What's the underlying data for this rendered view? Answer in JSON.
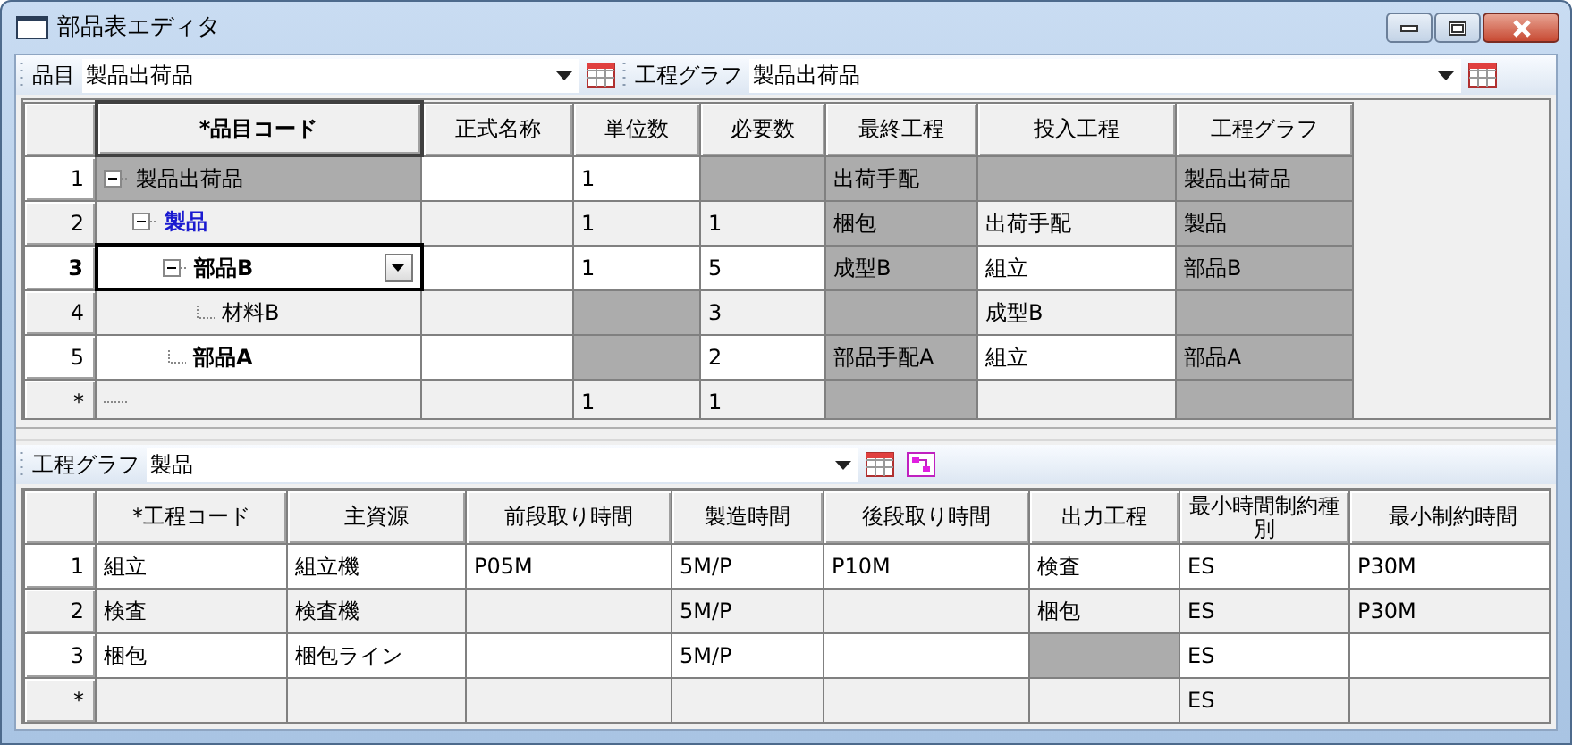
{
  "window": {
    "title": "部品表エディタ"
  },
  "toolbar": {
    "items": [
      {
        "label": "品目",
        "value": "製品出荷品"
      },
      {
        "label": "工程グラフ",
        "value": "製品出荷品"
      }
    ]
  },
  "bom_grid": {
    "columns": [
      {
        "label": "*品目コード",
        "selected": true
      },
      {
        "label": "正式名称",
        "selected": false
      },
      {
        "label": "単位数",
        "selected": false
      },
      {
        "label": "必要数",
        "selected": false
      },
      {
        "label": "最終工程",
        "selected": false
      },
      {
        "label": "投入工程",
        "selected": false
      },
      {
        "label": "工程グラフ",
        "selected": false
      }
    ],
    "rows": [
      {
        "number": "1",
        "selected": false,
        "kind": "plain",
        "expanded": true,
        "cells": [
          {
            "text": "製品出荷品",
            "shaded": true
          },
          {
            "shaded": false
          },
          {
            "text": "1",
            "shaded": false
          },
          {
            "shaded": true
          },
          {
            "text": "出荷手配",
            "shaded": true
          },
          {
            "shaded": true
          },
          {
            "text": "製品出荷品",
            "shaded": true
          }
        ],
        "children": [
          {
            "number": "2",
            "selected": false,
            "kind": "product",
            "expanded": true,
            "cells": [
              {
                "text": "製品",
                "shaded": false
              },
              {
                "shaded": false
              },
              {
                "text": "1",
                "shaded": false
              },
              {
                "text": "1",
                "shaded": false
              },
              {
                "text": "梱包",
                "shaded": true
              },
              {
                "text": "出荷手配",
                "shaded": false
              },
              {
                "text": "製品",
                "shaded": true
              }
            ],
            "children": [
              {
                "number": "3",
                "selected": true,
                "kind": "part",
                "expanded": true,
                "cells": [
                  {
                    "text": "部品B",
                    "shaded": false
                  },
                  {
                    "shaded": false
                  },
                  {
                    "text": "1",
                    "shaded": false
                  },
                  {
                    "text": "5",
                    "shaded": false
                  },
                  {
                    "text": "成型B",
                    "shaded": true
                  },
                  {
                    "text": "組立",
                    "shaded": false
                  },
                  {
                    "text": "部品B",
                    "shaded": true
                  }
                ],
                "children": [
                  {
                    "number": "4",
                    "selected": false,
                    "kind": "plain",
                    "cells": [
                      {
                        "text": "材料B",
                        "shaded": false
                      },
                      {
                        "shaded": false
                      },
                      {
                        "shaded": true
                      },
                      {
                        "text": "3",
                        "shaded": false
                      },
                      {
                        "shaded": true
                      },
                      {
                        "text": "成型B",
                        "shaded": false
                      },
                      {
                        "shaded": true
                      }
                    ]
                  }
                ]
              },
              {
                "number": "5",
                "selected": false,
                "kind": "part",
                "cells": [
                  {
                    "text": "部品A",
                    "shaded": false
                  },
                  {
                    "shaded": false
                  },
                  {
                    "shaded": true
                  },
                  {
                    "text": "2",
                    "shaded": false
                  },
                  {
                    "text": "部品手配A",
                    "shaded": true
                  },
                  {
                    "text": "組立",
                    "shaded": false
                  },
                  {
                    "text": "部品A",
                    "shaded": true
                  }
                ]
              }
            ]
          }
        ]
      }
    ],
    "new_row": {
      "marker": "*",
      "cells": [
        {
          "shaded": false
        },
        {
          "shaded": false
        },
        {
          "text": "1",
          "shaded": false
        },
        {
          "text": "1",
          "shaded": false
        },
        {
          "shaded": true
        },
        {
          "shaded": false
        },
        {
          "shaded": true
        }
      ]
    }
  },
  "process_toolbar": {
    "label": "工程グラフ",
    "value": "製品"
  },
  "process_grid": {
    "columns": [
      "*工程コード",
      "主資源",
      "前段取り時間",
      "製造時間",
      "後段取り時間",
      "出力工程",
      "最小時間制約種別",
      "最小制約時間"
    ],
    "rows": [
      {
        "number": "1",
        "cells": [
          {
            "text": "組立",
            "shaded": false
          },
          {
            "text": "組立機",
            "shaded": false
          },
          {
            "text": "P05M",
            "shaded": false
          },
          {
            "text": "5M/P",
            "shaded": false
          },
          {
            "text": "P10M",
            "shaded": false
          },
          {
            "text": "検査",
            "shaded": false
          },
          {
            "text": "ES",
            "shaded": false
          },
          {
            "text": "P30M",
            "shaded": false
          }
        ]
      },
      {
        "number": "2",
        "cells": [
          {
            "text": "検査",
            "shaded": false
          },
          {
            "text": "検査機",
            "shaded": false
          },
          {
            "shaded": false
          },
          {
            "text": "5M/P",
            "shaded": false
          },
          {
            "shaded": false
          },
          {
            "text": "梱包",
            "shaded": false
          },
          {
            "text": "ES",
            "shaded": false
          },
          {
            "text": "P30M",
            "shaded": false
          }
        ]
      },
      {
        "number": "3",
        "cells": [
          {
            "text": "梱包",
            "shaded": false
          },
          {
            "text": "梱包ライン",
            "shaded": false
          },
          {
            "shaded": false
          },
          {
            "text": "5M/P",
            "shaded": false
          },
          {
            "shaded": false
          },
          {
            "shaded": true
          },
          {
            "text": "ES",
            "shaded": false
          },
          {
            "shaded": false
          }
        ]
      }
    ],
    "new_row": {
      "marker": "*",
      "cells": [
        {
          "shaded": false
        },
        {
          "shaded": false
        },
        {
          "shaded": false
        },
        {
          "shaded": false
        },
        {
          "shaded": false
        },
        {
          "shaded": false
        },
        {
          "text": "ES",
          "shaded": false
        },
        {
          "shaded": false
        }
      ]
    }
  }
}
